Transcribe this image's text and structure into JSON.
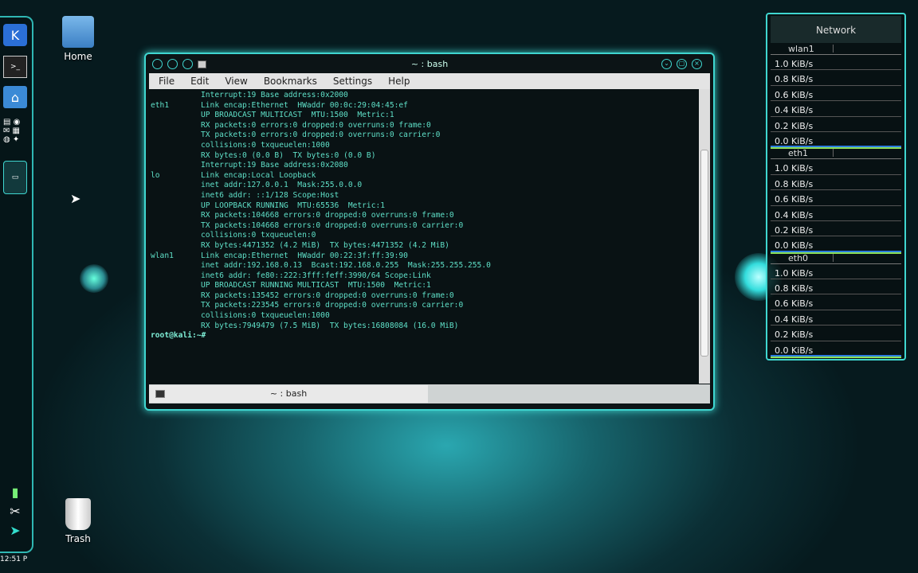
{
  "desktop": {
    "home_label": "Home",
    "trash_label": "Trash"
  },
  "panel": {
    "clock": "12:51 P",
    "icons": [
      "kde-menu-icon",
      "terminal-icon",
      "home-folder-icon",
      "app-icon",
      "browser-icon",
      "app-icon",
      "editor-icon",
      "network-icon",
      "settings-icon"
    ]
  },
  "window": {
    "title": "~ : bash",
    "menu": [
      "File",
      "Edit",
      "View",
      "Bookmarks",
      "Settings",
      "Help"
    ],
    "tab_label": "~ : bash"
  },
  "terminal": {
    "lines": [
      [
        "",
        "Interrupt:19 Base address:0x2000"
      ],
      [
        "",
        ""
      ],
      [
        "eth1",
        "Link encap:Ethernet  HWaddr 00:0c:29:04:45:ef"
      ],
      [
        "",
        "UP BROADCAST MULTICAST  MTU:1500  Metric:1"
      ],
      [
        "",
        "RX packets:0 errors:0 dropped:0 overruns:0 frame:0"
      ],
      [
        "",
        "TX packets:0 errors:0 dropped:0 overruns:0 carrier:0"
      ],
      [
        "",
        "collisions:0 txqueuelen:1000"
      ],
      [
        "",
        "RX bytes:0 (0.0 B)  TX bytes:0 (0.0 B)"
      ],
      [
        "",
        "Interrupt:19 Base address:0x2080"
      ],
      [
        "",
        ""
      ],
      [
        "lo",
        "Link encap:Local Loopback"
      ],
      [
        "",
        "inet addr:127.0.0.1  Mask:255.0.0.0"
      ],
      [
        "",
        "inet6 addr: ::1/128 Scope:Host"
      ],
      [
        "",
        "UP LOOPBACK RUNNING  MTU:65536  Metric:1"
      ],
      [
        "",
        "RX packets:104668 errors:0 dropped:0 overruns:0 frame:0"
      ],
      [
        "",
        "TX packets:104668 errors:0 dropped:0 overruns:0 carrier:0"
      ],
      [
        "",
        "collisions:0 txqueuelen:0"
      ],
      [
        "",
        "RX bytes:4471352 (4.2 MiB)  TX bytes:4471352 (4.2 MiB)"
      ],
      [
        "",
        ""
      ],
      [
        "wlan1",
        "Link encap:Ethernet  HWaddr 00:22:3f:ff:39:90"
      ],
      [
        "",
        "inet addr:192.168.0.13  Bcast:192.168.0.255  Mask:255.255.255.0"
      ],
      [
        "",
        "inet6 addr: fe80::222:3fff:feff:3990/64 Scope:Link"
      ],
      [
        "",
        "UP BROADCAST RUNNING MULTICAST  MTU:1500  Metric:1"
      ],
      [
        "",
        "RX packets:135452 errors:0 dropped:0 overruns:0 frame:0"
      ],
      [
        "",
        "TX packets:223545 errors:0 dropped:0 overruns:0 carrier:0"
      ],
      [
        "",
        "collisions:0 txqueuelen:1000"
      ],
      [
        "",
        "RX bytes:7949479 (7.5 MiB)  TX bytes:16808084 (16.0 MiB)"
      ],
      [
        "",
        ""
      ]
    ],
    "prompt": "root@kali:~#"
  },
  "network_widget": {
    "title": "Network",
    "sections": [
      {
        "name": "wlan1",
        "scale": [
          "1.0 KiB/s",
          "0.8 KiB/s",
          "0.6 KiB/s",
          "0.4 KiB/s",
          "0.2 KiB/s",
          "0.0 KiB/s"
        ]
      },
      {
        "name": "eth1",
        "scale": [
          "1.0 KiB/s",
          "0.8 KiB/s",
          "0.6 KiB/s",
          "0.4 KiB/s",
          "0.2 KiB/s",
          "0.0 KiB/s"
        ]
      },
      {
        "name": "eth0",
        "scale": [
          "1.0 KiB/s",
          "0.8 KiB/s",
          "0.6 KiB/s",
          "0.4 KiB/s",
          "0.2 KiB/s",
          "0.0 KiB/s"
        ]
      }
    ]
  }
}
